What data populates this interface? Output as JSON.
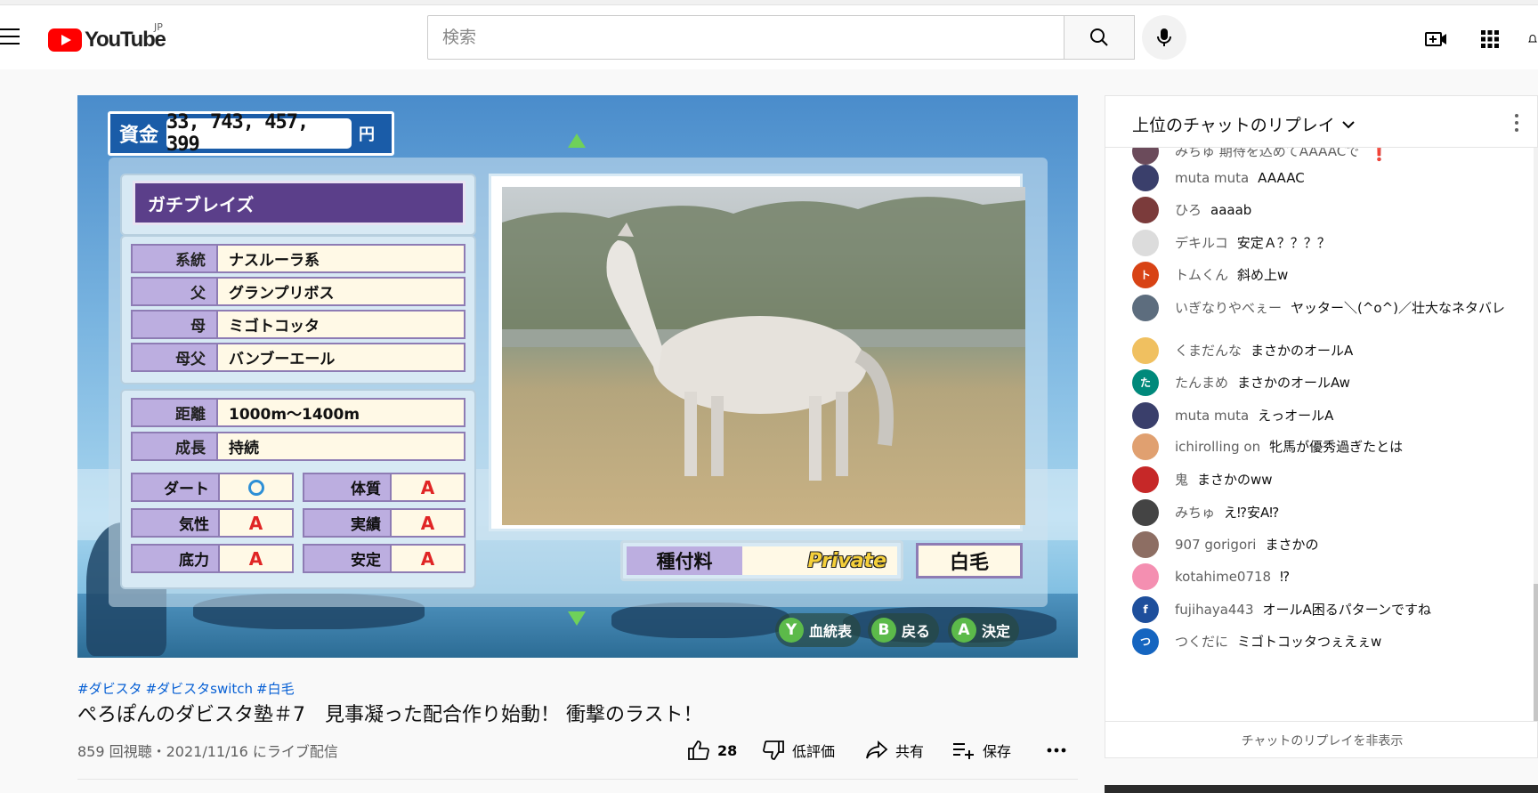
{
  "header": {
    "logo_text": "YouTube",
    "country_code": "JP",
    "search_placeholder": "検索"
  },
  "game": {
    "fund_label": "資金",
    "fund_value": "33, 743, 457, 399",
    "fund_unit": "円",
    "horse_name": "ガチブレイズ",
    "pedigree": [
      {
        "label": "系統",
        "value": "ナスルーラ系"
      },
      {
        "label": "父",
        "value": "グランプリボス"
      },
      {
        "label": "母",
        "value": "ミゴトコッタ"
      },
      {
        "label": "母父",
        "value": "バンブーエール"
      }
    ],
    "distance_label": "距離",
    "distance_value": "1000m～1400m",
    "growth_label": "成長",
    "growth_value": "持続",
    "stats": [
      {
        "label": "ダート",
        "value": "○"
      },
      {
        "label": "体質",
        "value": "A"
      },
      {
        "label": "気性",
        "value": "A"
      },
      {
        "label": "実績",
        "value": "A"
      },
      {
        "label": "底力",
        "value": "A"
      },
      {
        "label": "安定",
        "value": "A"
      }
    ],
    "fee_label": "種付料",
    "fee_value": "Private",
    "coat": "白毛",
    "hints": [
      {
        "key": "Y",
        "label": "血統表"
      },
      {
        "key": "B",
        "label": "戻る"
      },
      {
        "key": "A",
        "label": "決定"
      }
    ]
  },
  "video": {
    "hashtags": [
      "#ダビスタ",
      "#ダビスタswitch",
      "#白毛"
    ],
    "title": "ぺろぽんのダビスタ塾＃7　見事凝った配合作り始動！ 衝撃のラスト！",
    "views": "859 回視聴・2021/11/16 にライブ配信",
    "likes": "28",
    "dislike_label": "低評価",
    "share_label": "共有",
    "save_label": "保存"
  },
  "chat": {
    "title": "上位のチャットのリプレイ",
    "partial_top": "みちゅ  期待を込めてAAAACで",
    "messages": [
      {
        "author": "muta muta",
        "text": "AAAAC",
        "color": "#3a3f6b"
      },
      {
        "author": "ひろ",
        "text": "aaaab",
        "color": "#7b3b3b"
      },
      {
        "author": "デキルコ",
        "text": "安定Ａ？？？？",
        "color": "#dcdcdc"
      },
      {
        "author": "トムくん",
        "text": "斜め上w",
        "color": "#d84315",
        "initial": "ト"
      },
      {
        "author": "いぎなりやべぇー",
        "text": "ヤッター＼(^o^)／壮大なネタバレ",
        "color": "#5d6d7e"
      },
      {
        "author": "くまだんな",
        "text": "まさかのオールA",
        "color": "#f0c060"
      },
      {
        "author": "たんまめ",
        "text": "まさかのオールAw",
        "color": "#00897b",
        "initial": "た"
      },
      {
        "author": "muta muta",
        "text": "えっオールA",
        "color": "#3a3f6b"
      },
      {
        "author": "ichirolling on",
        "text": "牝馬が優秀過ぎたとは",
        "color": "#e0a070"
      },
      {
        "author": "鬼",
        "text": "まさかのww",
        "color": "#c62828"
      },
      {
        "author": "みちゅ",
        "text": "え⁉︎安A⁉︎",
        "color": "#444"
      },
      {
        "author": "907 gorigori",
        "text": "まさかの",
        "color": "#8d6e63"
      },
      {
        "author": "kotahime0718",
        "text": "⁉︎",
        "color": "#f48fb1"
      },
      {
        "author": "fujihaya443",
        "text": "オールA困るパターンですね",
        "color": "#1e4f9c",
        "initial": "f"
      },
      {
        "author": "つくだに",
        "text": "ミゴトコッタつぇえぇw",
        "color": "#1565c0",
        "initial": "つ"
      }
    ],
    "hide_label": "チャットのリプレイを非表示"
  }
}
